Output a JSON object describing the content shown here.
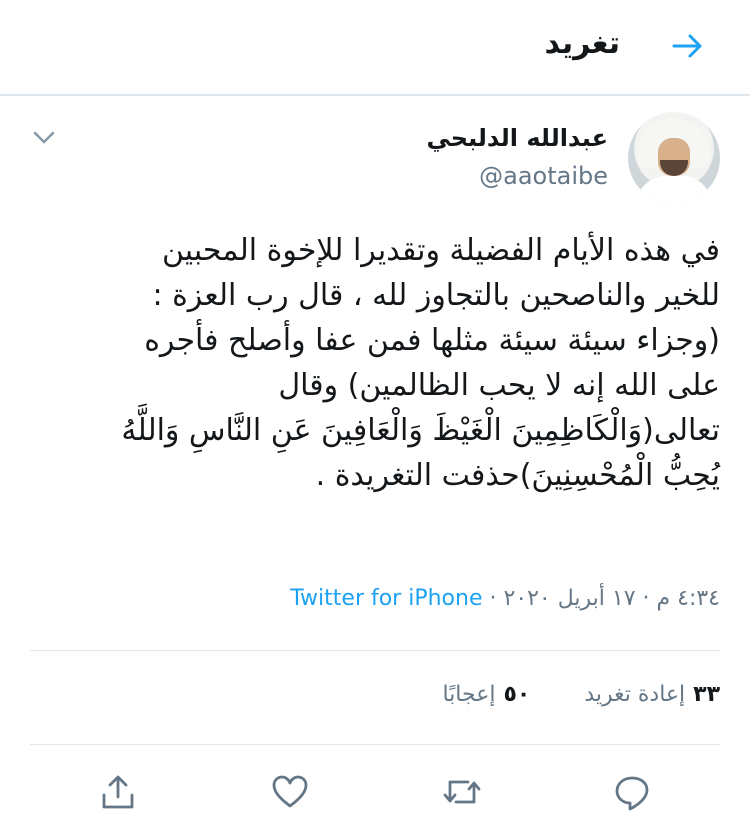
{
  "header": {
    "title": "تغريد",
    "back_icon": "arrow-right-icon",
    "accent": "#1da1f2"
  },
  "author": {
    "name": "عبدالله الدلبحي",
    "handle": "@aaotaibe"
  },
  "tweet": {
    "text": "في هذه الأيام الفضيلة وتقديرا للإخوة المحبين\nللخير والناصحين بالتجاوز لله ، قال رب العزة :\n(وجزاء سيئة سيئة مثلها فمن عفا وأصلح فأجره\nعلى الله إنه لا يحب الظالمين) وقال\nتعالى(وَالْكَاظِمِينَ الْغَيْظَ وَالْعَافِينَ عَنِ النَّاسِ وَاللَّهُ\nيُحِبُّ الْمُحْسِنِينَ)حذفت التغريدة .",
    "timestamp": "٤:٣٤ م · ١٧ أبريل ٢٠٢٠ · ",
    "source": "Twitter for iPhone"
  },
  "stats": {
    "retweets_count": "٣٣",
    "retweets_label": "إعادة تغريد",
    "likes_count": "٥٠",
    "likes_label": "إعجابًا"
  },
  "actions": [
    "reply-icon",
    "retweet-icon",
    "like-icon",
    "share-icon"
  ]
}
